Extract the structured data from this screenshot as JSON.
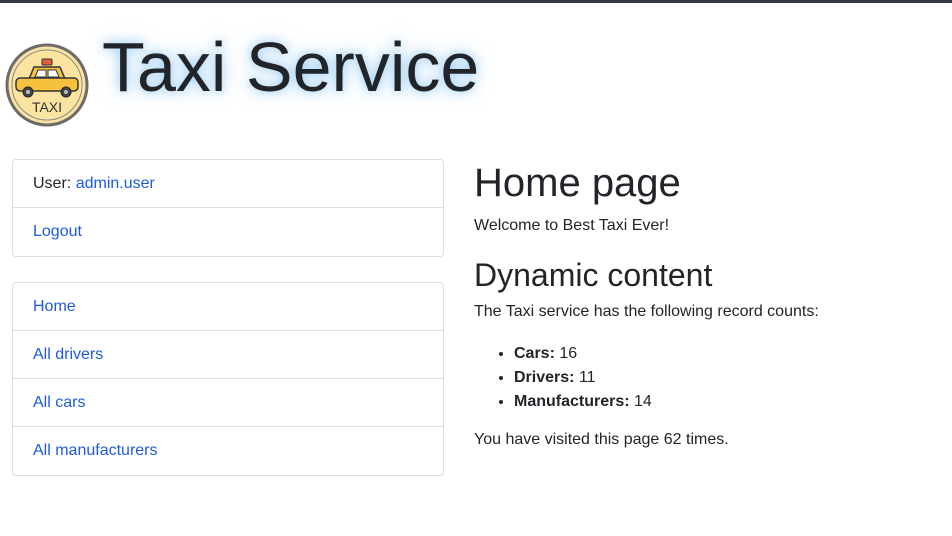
{
  "header": {
    "title": "Taxi Service",
    "logo_text": "TAXI"
  },
  "user_panel": {
    "user_label": "User:",
    "username": "admin.user",
    "logout": "Logout"
  },
  "nav": {
    "items": [
      {
        "label": "Home"
      },
      {
        "label": "All drivers"
      },
      {
        "label": "All cars"
      },
      {
        "label": "All manufacturers"
      }
    ]
  },
  "main": {
    "page_title": "Home page",
    "welcome": "Welcome to Best Taxi Ever!",
    "dynamic_title": "Dynamic content",
    "counts_intro": "The Taxi service has the following record counts:",
    "counts": [
      {
        "label": "Cars:",
        "value": "16"
      },
      {
        "label": "Drivers:",
        "value": "11"
      },
      {
        "label": "Manufacturers:",
        "value": "14"
      }
    ],
    "visits_prefix": "You have visited this page",
    "visits_count": "62",
    "visits_suffix": "times."
  },
  "colors": {
    "link": "#1f5ae0",
    "text": "#212529",
    "border": "#dcdfe3",
    "taxi_yellow": "#f6c23e",
    "logo_bg": "#fbe3a0"
  },
  "icons": {
    "logo": "taxi-logo-icon"
  }
}
